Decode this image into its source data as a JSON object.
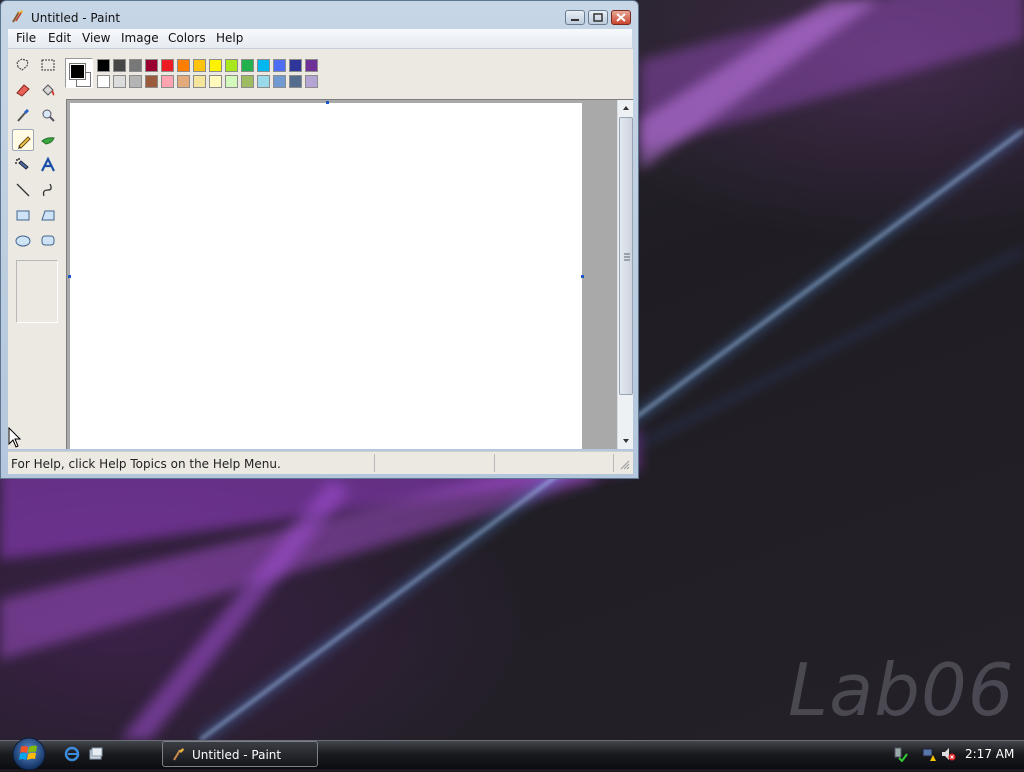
{
  "window": {
    "title": "Untitled - Paint"
  },
  "menu": [
    "File",
    "Edit",
    "View",
    "Image",
    "Colors",
    "Help"
  ],
  "tools": [
    {
      "name": "free-form-select",
      "selected": false
    },
    {
      "name": "select",
      "selected": false
    },
    {
      "name": "eraser",
      "selected": false
    },
    {
      "name": "fill-with-color",
      "selected": false
    },
    {
      "name": "pick-color",
      "selected": false
    },
    {
      "name": "magnifier",
      "selected": false
    },
    {
      "name": "pencil",
      "selected": true
    },
    {
      "name": "brush",
      "selected": false
    },
    {
      "name": "airbrush",
      "selected": false
    },
    {
      "name": "text",
      "selected": false
    },
    {
      "name": "line",
      "selected": false
    },
    {
      "name": "curve",
      "selected": false
    },
    {
      "name": "rectangle",
      "selected": false
    },
    {
      "name": "polygon",
      "selected": false
    },
    {
      "name": "ellipse",
      "selected": false
    },
    {
      "name": "rounded-rectangle",
      "selected": false
    }
  ],
  "palette": {
    "foreground": "#000000",
    "background": "#ffffff",
    "row1": [
      "#000000",
      "#464646",
      "#787878",
      "#990030",
      "#ed1c24",
      "#ff7e00",
      "#ffc20e",
      "#fff200",
      "#a8e61d",
      "#22b14c",
      "#00b7ef",
      "#4d6df3",
      "#2f3699",
      "#6f3198"
    ],
    "row2": [
      "#ffffff",
      "#dcdcdc",
      "#b4b4b4",
      "#9c5a3c",
      "#ffa3b1",
      "#e5aa7a",
      "#f5e49c",
      "#fff9bd",
      "#d3f9bc",
      "#9dbb61",
      "#99d9ea",
      "#709ad1",
      "#546d8e",
      "#b5a5d5"
    ]
  },
  "status": {
    "help_text": "For Help, click Help Topics on the Help Menu."
  },
  "desktop": {
    "watermark": "Lab06"
  },
  "taskbar": {
    "task_label": "Untitled - Paint",
    "clock": "2:17 AM"
  }
}
